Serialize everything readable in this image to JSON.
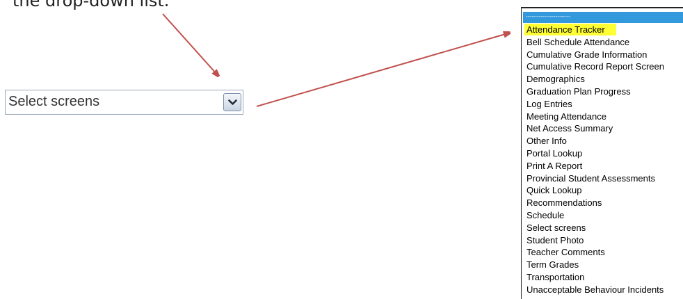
{
  "caption": "the drop-down list.",
  "select": {
    "value": "Select screens"
  },
  "dropdown": {
    "selected_label": "------------------------",
    "items": [
      "Attendance Tracker",
      "Bell Schedule Attendance",
      "Cumulative Grade Information",
      "Cumulative Record Report Screen",
      "Demographics",
      "Graduation Plan Progress",
      "Log Entries",
      "Meeting Attendance",
      "Net Access Summary",
      "Other Info",
      "Portal Lookup",
      "Print A Report",
      "Provincial Student Assessments",
      "Quick Lookup",
      "Recommendations",
      "Schedule",
      "Select screens",
      "Student Photo",
      "Teacher Comments",
      "Term Grades",
      "Transportation",
      "Unacceptable Behaviour Incidents"
    ],
    "highlighted_item": "Attendance Tracker"
  },
  "colors": {
    "arrow": "#c0504d",
    "selected_bg": "#3399dd",
    "highlight": "#ffff33"
  },
  "icons": {
    "dropdown_button": "chevron-down-icon"
  }
}
